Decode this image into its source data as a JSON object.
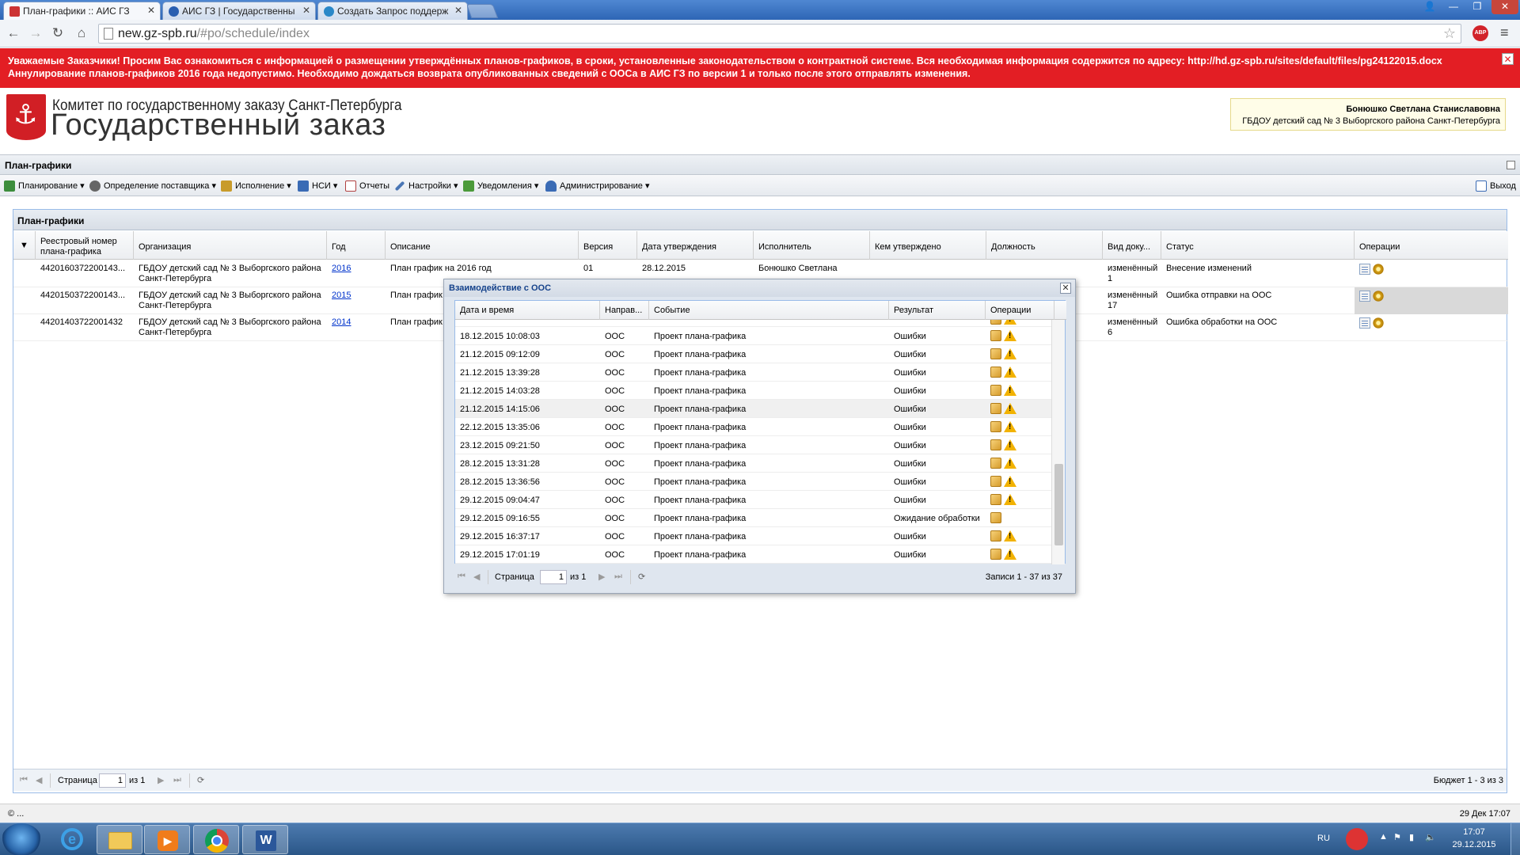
{
  "browser": {
    "tabs": [
      {
        "title": "План-графики :: АИС ГЗ",
        "active": true,
        "color": "#c33"
      },
      {
        "title": "АИС ГЗ | Государственны",
        "active": false,
        "color": "#2a5fb0"
      },
      {
        "title": "Создать Запрос поддерж",
        "active": false,
        "color": "#2a88c8"
      }
    ],
    "url_host": "new.gz-spb.ru",
    "url_path": "/#po/schedule/index",
    "abp": "ABP"
  },
  "banner": {
    "text": "Уважаемые Заказчики! Просим Вас ознакомиться с информацией о размещении утверждённых планов-графиков, в сроки, установленные законодательством о контрактной системе. Вся необходимая информация содержится по адресу: http://hd.gz-spb.ru/sites/default/files/pg24122015.docx Аннулирование планов-графиков 2016 года недопустимо. Необходимо дождаться возврата опубликованных сведений с ООСа в АИС ГЗ по версии 1 и только после этого отправлять изменения.",
    "close": "✕"
  },
  "logo": {
    "line1": "Комитет по государственному заказу Санкт-Петербурга",
    "line2": "Государственный заказ"
  },
  "user": {
    "name": "Бонюшко Светлана Станиславовна",
    "org": "ГБДОУ детский сад № 3 Выборгского района Санкт-Петербурга"
  },
  "section_title": "План-графики",
  "menu": [
    {
      "label": "Планирование",
      "icon": "planning-icon",
      "color": "#3c8d3c"
    },
    {
      "label": "Определение поставщика",
      "icon": "supplier-icon",
      "color": "#555"
    },
    {
      "label": "Исполнение",
      "icon": "execution-icon",
      "color": "#c89b2a"
    },
    {
      "label": "НСИ",
      "icon": "reference-book-icon",
      "color": "#3a6bb5"
    },
    {
      "label": "Отчеты",
      "icon": "report-icon",
      "color": "#b04040"
    },
    {
      "label": "Настройки",
      "icon": "settings-icon",
      "color": "#4a76b5"
    },
    {
      "label": "Уведомления",
      "icon": "notifications-icon",
      "color": "#4b9a3a"
    },
    {
      "label": "Администрирование",
      "icon": "admin-icon",
      "color": "#3a6bb5"
    }
  ],
  "logout": "Выход",
  "grid": {
    "title": "План-графики",
    "columns": [
      "Реестровый номер плана-графика",
      "Организация",
      "Год",
      "Описание",
      "Версия",
      "Дата утверждения",
      "Исполнитель",
      "Кем утверждено",
      "Должность",
      "Вид доку...",
      "Статус",
      "Операции"
    ],
    "rows": [
      {
        "reg": "4420160372200143...",
        "org": "ГБДОУ детский сад № 3 Выборгского района Санкт-Петербурга",
        "year": "2016",
        "desc": "План график на 2016 год",
        "version": "01",
        "date": "28.12.2015",
        "exec": "Бонюшко Светлана",
        "approved": "",
        "position": "",
        "doctype": "изменённый 1",
        "status": "Внесение изменений"
      },
      {
        "reg": "4420150372200143...",
        "org": "ГБДОУ детский сад № 3 Выборгского района Санкт-Петербурга",
        "year": "2015",
        "desc": "План график",
        "version": "",
        "date": "",
        "exec": "",
        "approved": "",
        "position": "",
        "doctype": "изменённый 17",
        "status": "Ошибка отправки на ООС"
      },
      {
        "reg": "44201403722001432",
        "org": "ГБДОУ детский сад № 3 Выборгского района Санкт-Петербурга",
        "year": "2014",
        "desc": "План график",
        "version": "",
        "date": "",
        "exec": "",
        "approved": "",
        "position": "",
        "doctype": "изменённый 6",
        "status": "Ошибка обработки на ООС"
      }
    ],
    "pager": {
      "page_label": "Страница",
      "page": "1",
      "of": "из 1",
      "summary": "Бюджет 1 - 3 из 3"
    }
  },
  "dialog": {
    "title": "Взаимодействие с ООС",
    "close": "✕",
    "columns": [
      "Дата и время",
      "Направ...",
      "Событие",
      "Результат",
      "Операции"
    ],
    "rows": [
      {
        "dt": "18.12.2015 10:08:03",
        "dir": "ООС",
        "event": "Проект плана-графика",
        "result": "Ошибки",
        "warn": true
      },
      {
        "dt": "21.12.2015 09:12:09",
        "dir": "ООС",
        "event": "Проект плана-графика",
        "result": "Ошибки",
        "warn": true
      },
      {
        "dt": "21.12.2015 13:39:28",
        "dir": "ООС",
        "event": "Проект плана-графика",
        "result": "Ошибки",
        "warn": true
      },
      {
        "dt": "21.12.2015 14:03:28",
        "dir": "ООС",
        "event": "Проект плана-графика",
        "result": "Ошибки",
        "warn": true
      },
      {
        "dt": "21.12.2015 14:15:06",
        "dir": "ООС",
        "event": "Проект плана-графика",
        "result": "Ошибки",
        "warn": true
      },
      {
        "dt": "22.12.2015 13:35:06",
        "dir": "ООС",
        "event": "Проект плана-графика",
        "result": "Ошибки",
        "warn": true
      },
      {
        "dt": "23.12.2015 09:21:50",
        "dir": "ООС",
        "event": "Проект плана-графика",
        "result": "Ошибки",
        "warn": true
      },
      {
        "dt": "28.12.2015 13:31:28",
        "dir": "ООС",
        "event": "Проект плана-графика",
        "result": "Ошибки",
        "warn": true
      },
      {
        "dt": "28.12.2015 13:36:56",
        "dir": "ООС",
        "event": "Проект плана-графика",
        "result": "Ошибки",
        "warn": true
      },
      {
        "dt": "29.12.2015 09:04:47",
        "dir": "ООС",
        "event": "Проект плана-графика",
        "result": "Ошибки",
        "warn": true
      },
      {
        "dt": "29.12.2015 09:16:55",
        "dir": "ООС",
        "event": "Проект плана-графика",
        "result": "Ожидание обработки",
        "warn": false
      },
      {
        "dt": "29.12.2015 16:37:17",
        "dir": "ООС",
        "event": "Проект плана-графика",
        "result": "Ошибки",
        "warn": true
      },
      {
        "dt": "29.12.2015 17:01:19",
        "dir": "ООС",
        "event": "Проект плана-графика",
        "result": "Ошибки",
        "warn": true
      }
    ],
    "pager": {
      "page_label": "Страница",
      "page": "1",
      "of": "из 1",
      "summary": "Записи 1 - 37 из 37"
    }
  },
  "statusbar": {
    "left": "© ...",
    "right": "29 Дек 17:07"
  },
  "taskbar": {
    "lang": "RU",
    "time": "17:07",
    "date": "29.12.2015"
  }
}
